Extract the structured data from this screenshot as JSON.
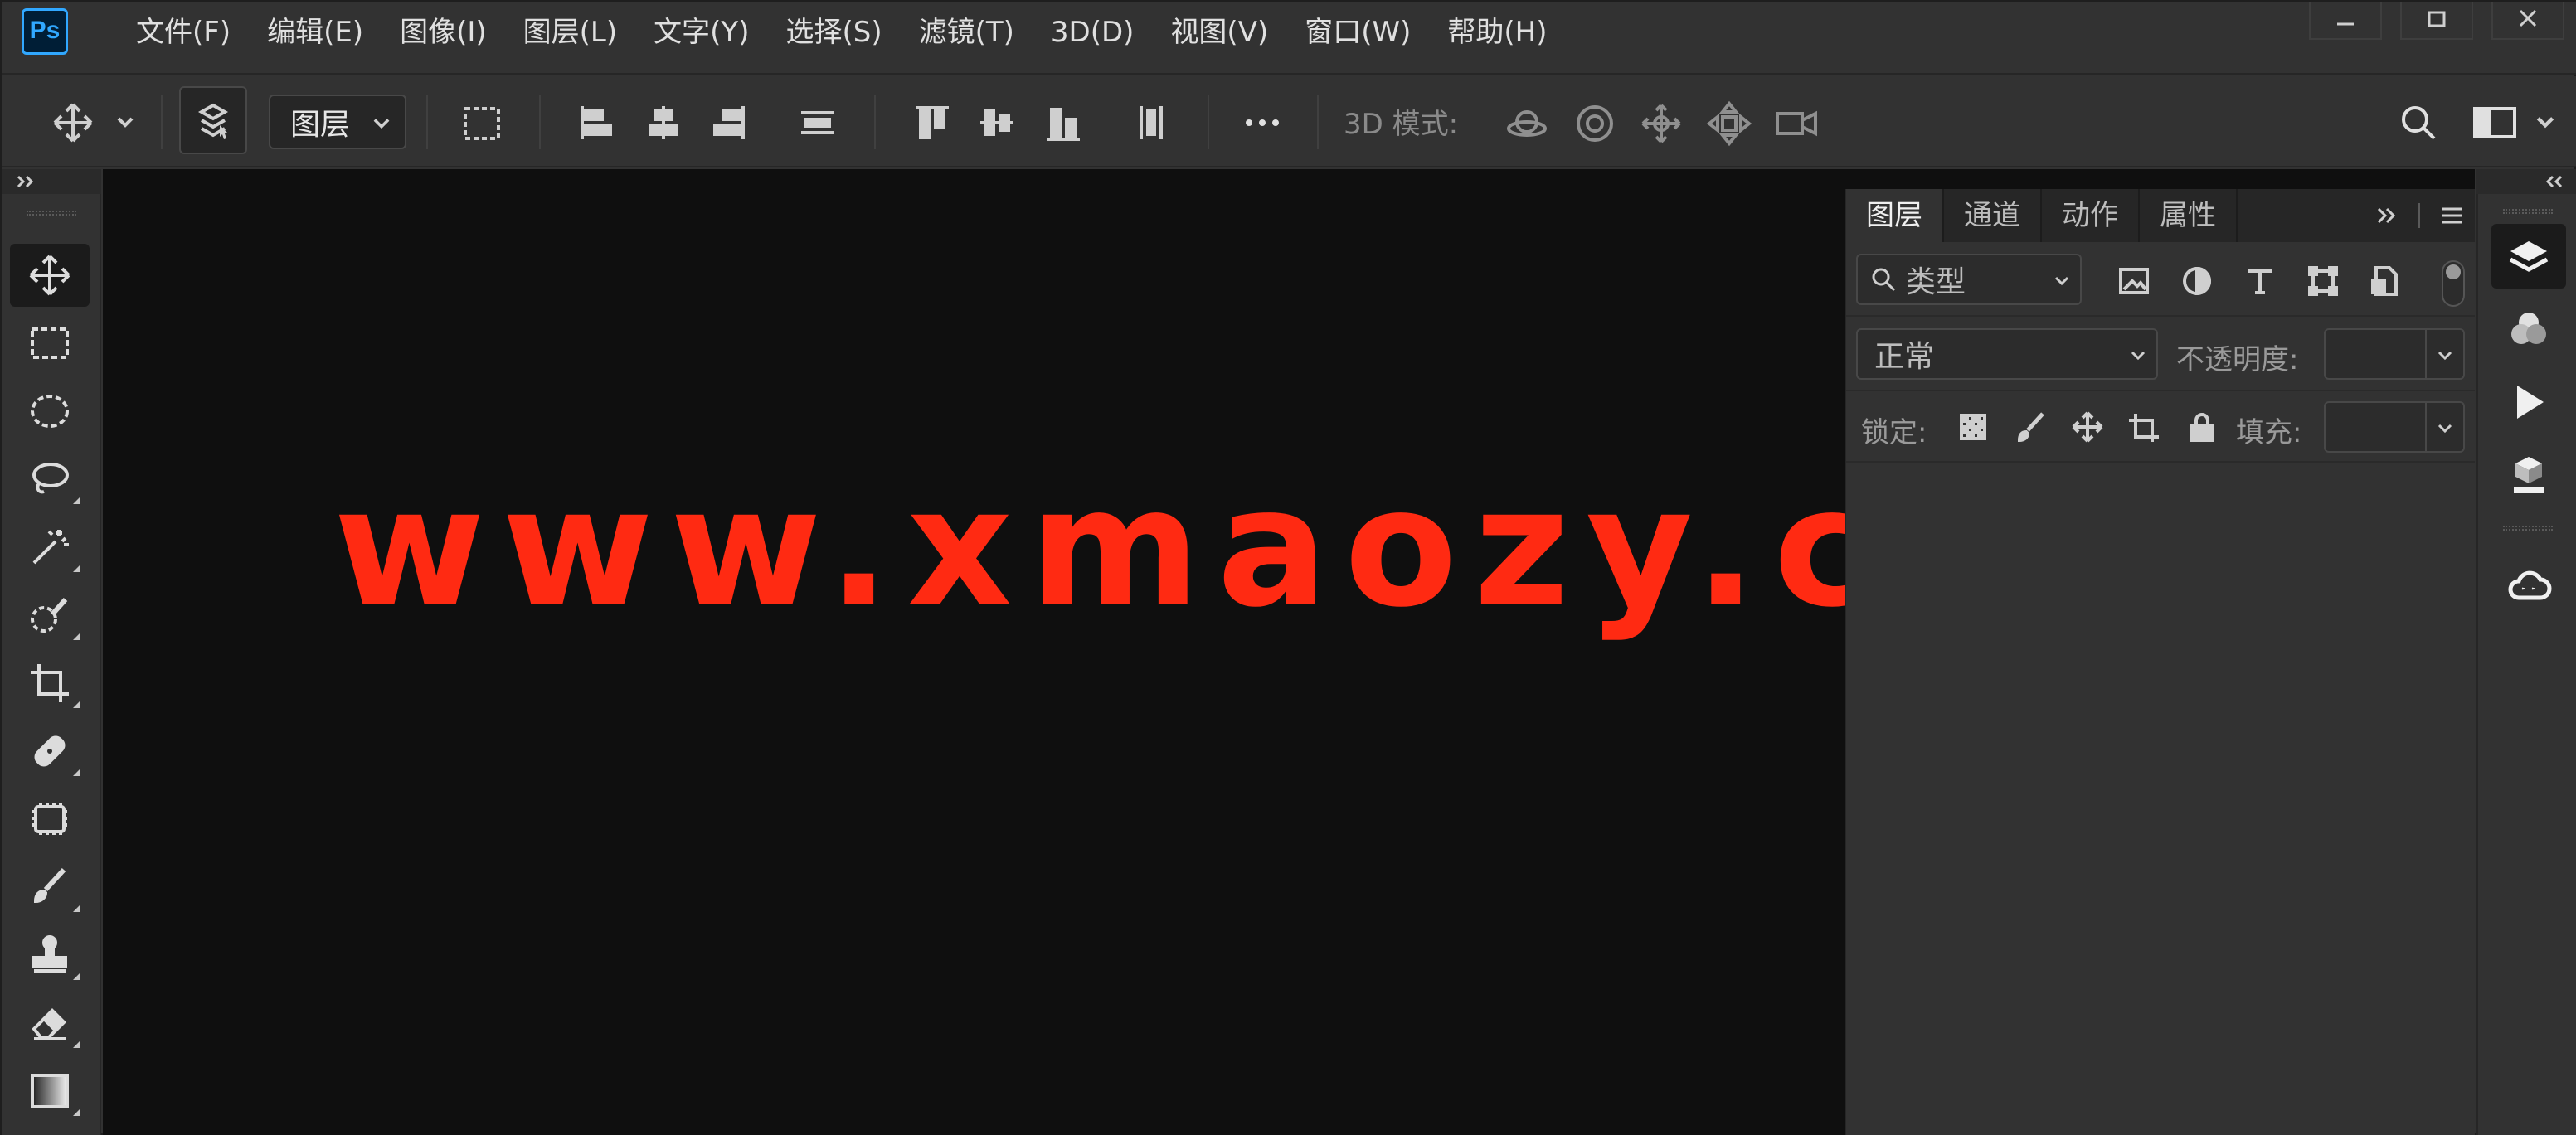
{
  "app": {
    "logo_text": "Ps",
    "accent_color": "#31a8ff"
  },
  "menu": {
    "items": [
      {
        "label": "文件(F)"
      },
      {
        "label": "编辑(E)"
      },
      {
        "label": "图像(I)"
      },
      {
        "label": "图层(L)"
      },
      {
        "label": "文字(Y)"
      },
      {
        "label": "选择(S)"
      },
      {
        "label": "滤镜(T)"
      },
      {
        "label": "3D(D)"
      },
      {
        "label": "视图(V)"
      },
      {
        "label": "窗口(W)"
      },
      {
        "label": "帮助(H)"
      }
    ]
  },
  "options_bar": {
    "auto_select_target": "图层",
    "mode_3d_label": "3D 模式:"
  },
  "canvas": {
    "background_color": "#0f0f0f",
    "watermark_text": "www.xmaozy.com",
    "watermark_color": "#ff2a12"
  },
  "layers_panel": {
    "tabs": [
      {
        "label": "图层",
        "active": true
      },
      {
        "label": "通道",
        "active": false
      },
      {
        "label": "动作",
        "active": false
      },
      {
        "label": "属性",
        "active": false
      }
    ],
    "filter_type": "类型",
    "blend_mode": "正常",
    "opacity_label": "不透明度:",
    "opacity_value": "",
    "lock_label": "锁定:",
    "fill_label": "填充:",
    "fill_value": ""
  },
  "icons": {
    "tools": [
      "move-tool-icon",
      "rectangular-marquee-icon",
      "elliptical-marquee-icon",
      "lasso-icon",
      "magic-wand-icon",
      "quick-selection-icon",
      "crop-icon",
      "healing-brush-icon",
      "patch-icon",
      "brush-icon",
      "clone-stamp-icon",
      "eraser-icon",
      "gradient-icon"
    ],
    "right_strip": [
      "layers-icon",
      "channels-icon",
      "actions-play-icon",
      "3d-icon",
      "creative-cloud-icon"
    ]
  }
}
